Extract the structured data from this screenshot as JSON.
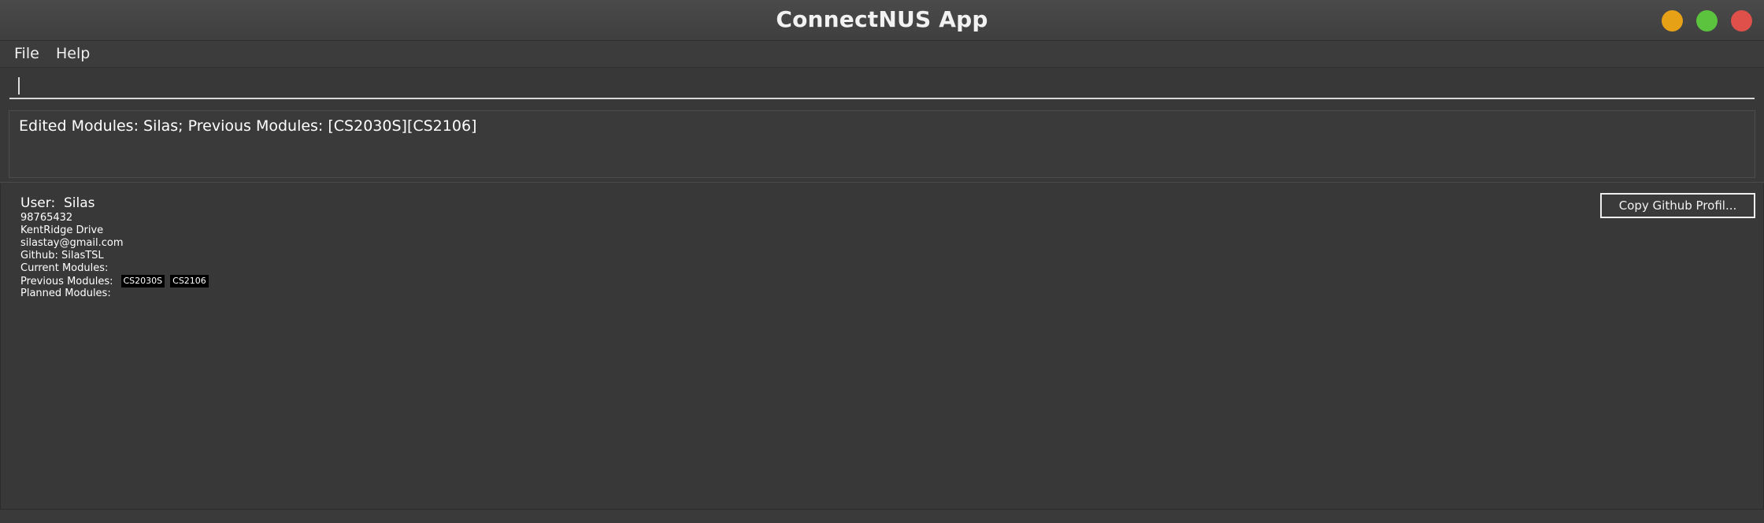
{
  "window": {
    "title": "ConnectNUS App",
    "controls": {
      "minimize_color": "#e6a117",
      "maximize_color": "#5cc33f",
      "close_color": "#e0504a"
    }
  },
  "menu": {
    "items": [
      {
        "label": "File"
      },
      {
        "label": "Help"
      }
    ]
  },
  "command_box": {
    "value": "",
    "placeholder": ""
  },
  "result_display": {
    "text": "Edited Modules: Silas; Previous Modules: [CS2030S][CS2106]"
  },
  "profile": {
    "name_line": "User:  Silas",
    "phone": "98765432",
    "address": "KentRidge Drive",
    "email": "silastay@gmail.com",
    "github": "Github: SilasTSL",
    "current_modules_label": "Current Modules:",
    "current_modules": [],
    "previous_modules_label": "Previous Modules:",
    "previous_modules": [
      "CS2030S",
      "CS2106"
    ],
    "planned_modules_label": "Planned Modules:",
    "planned_modules": [],
    "copy_button_label": "Copy Github Profil..."
  }
}
